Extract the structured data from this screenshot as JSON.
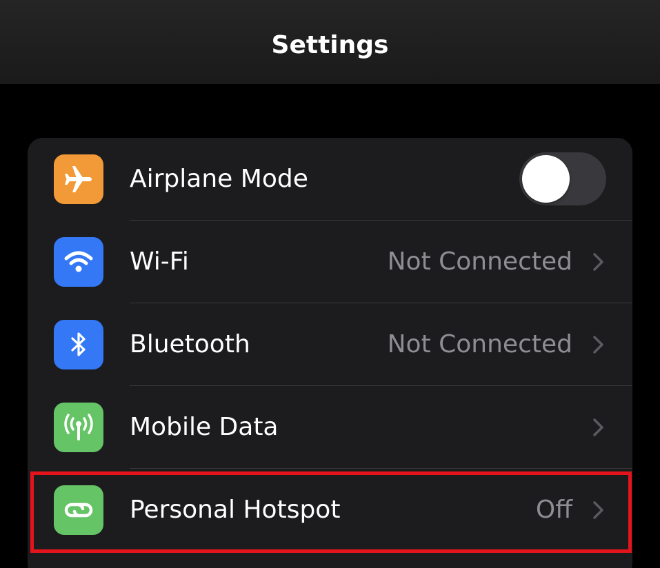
{
  "navbar": {
    "title": "Settings"
  },
  "settings": {
    "rows": [
      {
        "label": "Airplane Mode",
        "icon": "airplane-icon",
        "icon_color": "#f19a37",
        "control": "toggle",
        "toggle_on": false
      },
      {
        "label": "Wi-Fi",
        "icon": "wifi-icon",
        "icon_color": "#3478f6",
        "value": "Not Connected",
        "control": "chevron"
      },
      {
        "label": "Bluetooth",
        "icon": "bluetooth-icon",
        "icon_color": "#3478f6",
        "value": "Not Connected",
        "control": "chevron"
      },
      {
        "label": "Mobile Data",
        "icon": "antenna-icon",
        "icon_color": "#65c466",
        "control": "chevron"
      },
      {
        "label": "Personal Hotspot",
        "icon": "hotspot-link-icon",
        "icon_color": "#65c466",
        "value": "Off",
        "control": "chevron",
        "highlighted": true
      }
    ]
  },
  "colors": {
    "background": "#000000",
    "group_background": "#1c1c1e",
    "secondary_text": "#8d8d93",
    "highlight_border": "#e3141b"
  }
}
